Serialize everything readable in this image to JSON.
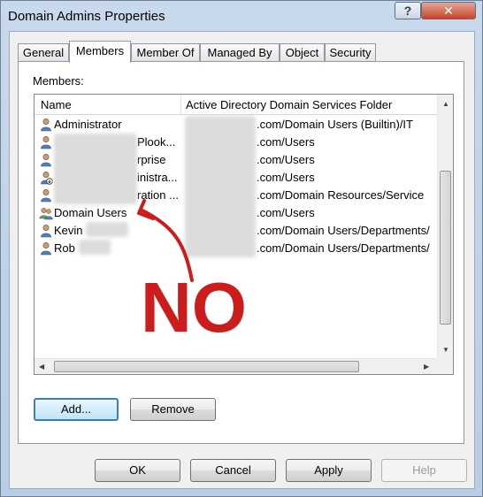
{
  "window": {
    "title": "Domain Admins Properties",
    "help_icon": "question-mark-icon",
    "close_icon": "close-icon"
  },
  "tabs": [
    {
      "label": "General"
    },
    {
      "label": "Members"
    },
    {
      "label": "Member Of"
    },
    {
      "label": "Managed By"
    },
    {
      "label": "Object"
    },
    {
      "label": "Security"
    }
  ],
  "active_tab": "Members",
  "members_label": "Members:",
  "columns": {
    "name": "Name",
    "folder": "Active Directory Domain Services Folder"
  },
  "rows": [
    {
      "name": "Administrator",
      "folder": ".com/Domain Users (Builtin)/IT",
      "icon": "user-icon"
    },
    {
      "name": "Plook...",
      "folder": ".com/Users",
      "icon": "user-icon"
    },
    {
      "name": "rprise",
      "folder": ".com/Users",
      "icon": "user-icon"
    },
    {
      "name": "inistra...",
      "folder": ".com/Users",
      "icon": "user-disabled-icon"
    },
    {
      "name": "ration ...",
      "folder": ".com/Domain Resources/Service",
      "icon": "user-icon"
    },
    {
      "name": "Domain Users",
      "folder": ".com/Users",
      "icon": "group-icon"
    },
    {
      "name": "Kevin",
      "folder": ".com/Domain Users/Departments/",
      "icon": "user-icon"
    },
    {
      "name": "Rob",
      "folder": ".com/Domain Users/Departments/",
      "icon": "user-icon"
    }
  ],
  "annotation": {
    "text": "NO",
    "color": "#cc1d1d"
  },
  "buttons": {
    "add": "Add...",
    "remove": "Remove",
    "ok": "OK",
    "cancel": "Cancel",
    "apply": "Apply",
    "help": "Help"
  }
}
